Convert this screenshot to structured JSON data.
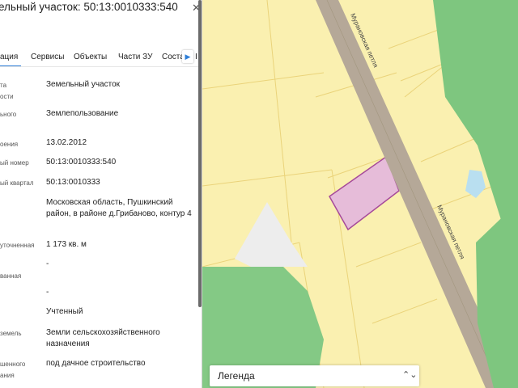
{
  "header": {
    "title": "ельный участок: 50:13:0010333:540",
    "close_icon": "close-icon"
  },
  "tabs": [
    {
      "label": "ация",
      "active": true
    },
    {
      "label": "Сервисы"
    },
    {
      "label": "Объекты"
    },
    {
      "label": "Части ЗУ"
    },
    {
      "label": "Соста"
    },
    {
      "label": "I"
    }
  ],
  "fields": [
    {
      "label1": "та",
      "label2": "ости",
      "value": "Земельный участок"
    },
    {
      "label1": "ьного",
      "label2": "",
      "value": "Землепользование"
    },
    {
      "label1": "оения",
      "label2": "",
      "value": "13.02.2012"
    },
    {
      "label1": "ый номер",
      "label2": "",
      "value": "50:13:0010333:540"
    },
    {
      "label1": "ый квартал",
      "label2": "",
      "value": "50:13:0010333"
    },
    {
      "label1": "",
      "label2": "",
      "value": "Московская область, Пушкинский район, в районе д.Грибаново, контур 4"
    },
    {
      "label1": "уточненная",
      "label2": "",
      "value": "1 173 кв. м"
    },
    {
      "label1": "",
      "label2": "ванная",
      "value": "-"
    },
    {
      "label1": "",
      "label2": "",
      "value": "-"
    },
    {
      "label1": "",
      "label2": "",
      "value": "Учтенный"
    },
    {
      "label1": "земель",
      "label2": "",
      "value": "Земли сельскохозяйственного назначения"
    },
    {
      "label1": "шенного",
      "label2": "ания",
      "value": "под дачное строительство"
    }
  ],
  "map": {
    "road_labels": [
      "Мурановская петля",
      "Мурановская петля"
    ],
    "colors": {
      "parcel_fill": "#faf0b0",
      "parcel_stroke": "#e9d46a",
      "road": "#b5a997",
      "green": "#7cc47c",
      "selected": "#e3b6d6"
    }
  },
  "legend": {
    "label": "Легенда",
    "chevron_icon": "chevron-updown-icon"
  }
}
